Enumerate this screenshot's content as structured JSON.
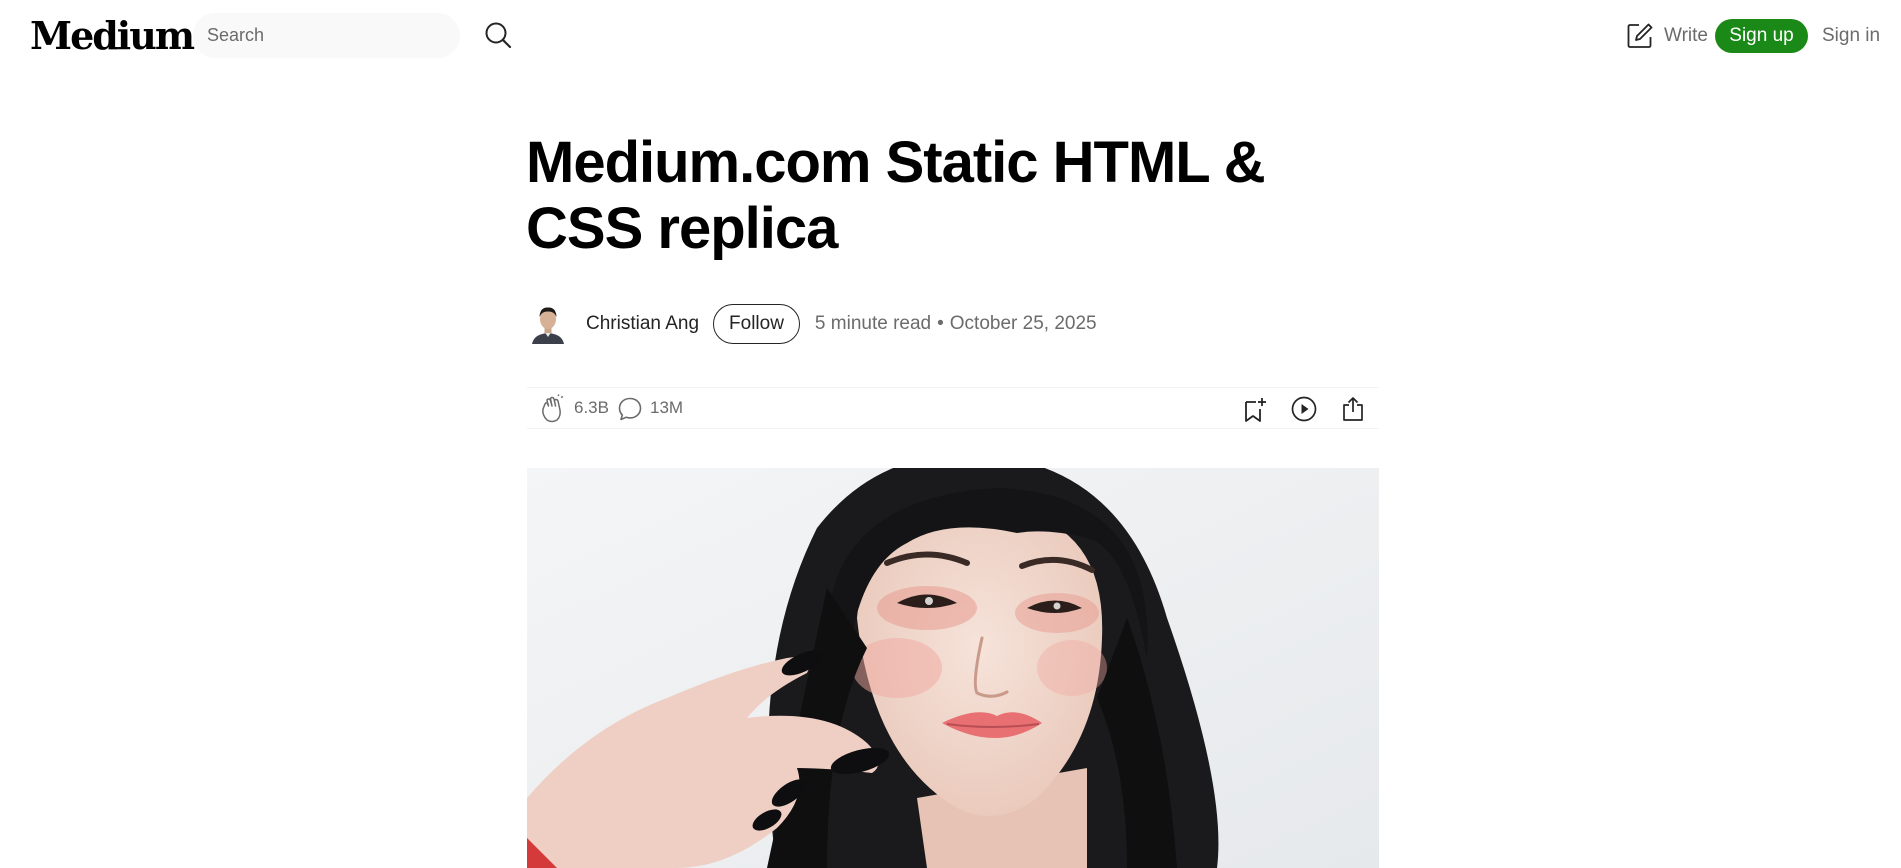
{
  "header": {
    "logo": "Medium",
    "search_placeholder": "Search",
    "write_label": "Write",
    "signup_label": "Sign up",
    "signin_label": "Sign in",
    "accent_color": "#1a8917"
  },
  "article": {
    "title": "Medium.com Static HTML & CSS replica",
    "author": "Christian Ang",
    "follow_label": "Follow",
    "read_time": "5 minute read",
    "separator": "•",
    "date": "October 25, 2025",
    "claps": "6.3B",
    "comments": "13M"
  },
  "icons": [
    "search-icon",
    "write-icon",
    "clap-icon",
    "comment-icon",
    "bookmark-add-icon",
    "play-circle-icon",
    "share-icon"
  ]
}
